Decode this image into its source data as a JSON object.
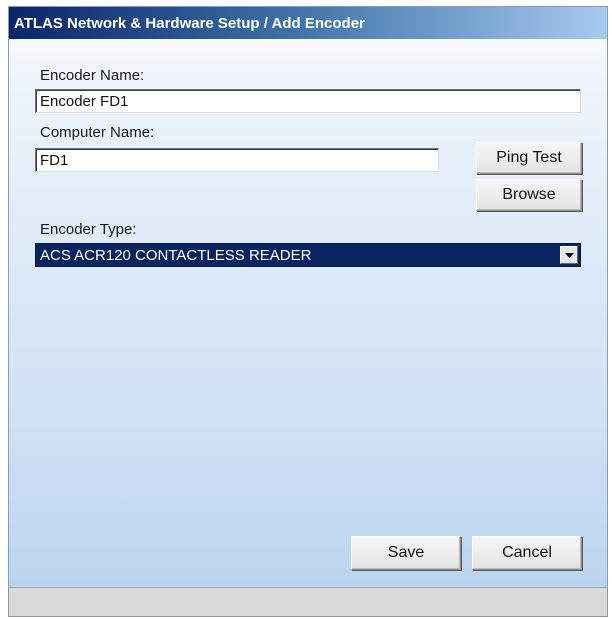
{
  "window": {
    "title": "ATLAS Network & Hardware Setup / Add Encoder"
  },
  "form": {
    "encoder_name_label": "Encoder Name:",
    "encoder_name_value": "Encoder FD1",
    "computer_name_label": "Computer Name:",
    "computer_name_value": "FD1",
    "encoder_type_label": "Encoder Type:",
    "encoder_type_value": "ACS ACR120 CONTACTLESS READER"
  },
  "buttons": {
    "ping_test": "Ping Test",
    "browse": "Browse",
    "save": "Save",
    "cancel": "Cancel"
  },
  "colors": {
    "title_bar": "#0a246a",
    "combo_selected": "#0a2462",
    "form_background": "#cfe0f5"
  }
}
